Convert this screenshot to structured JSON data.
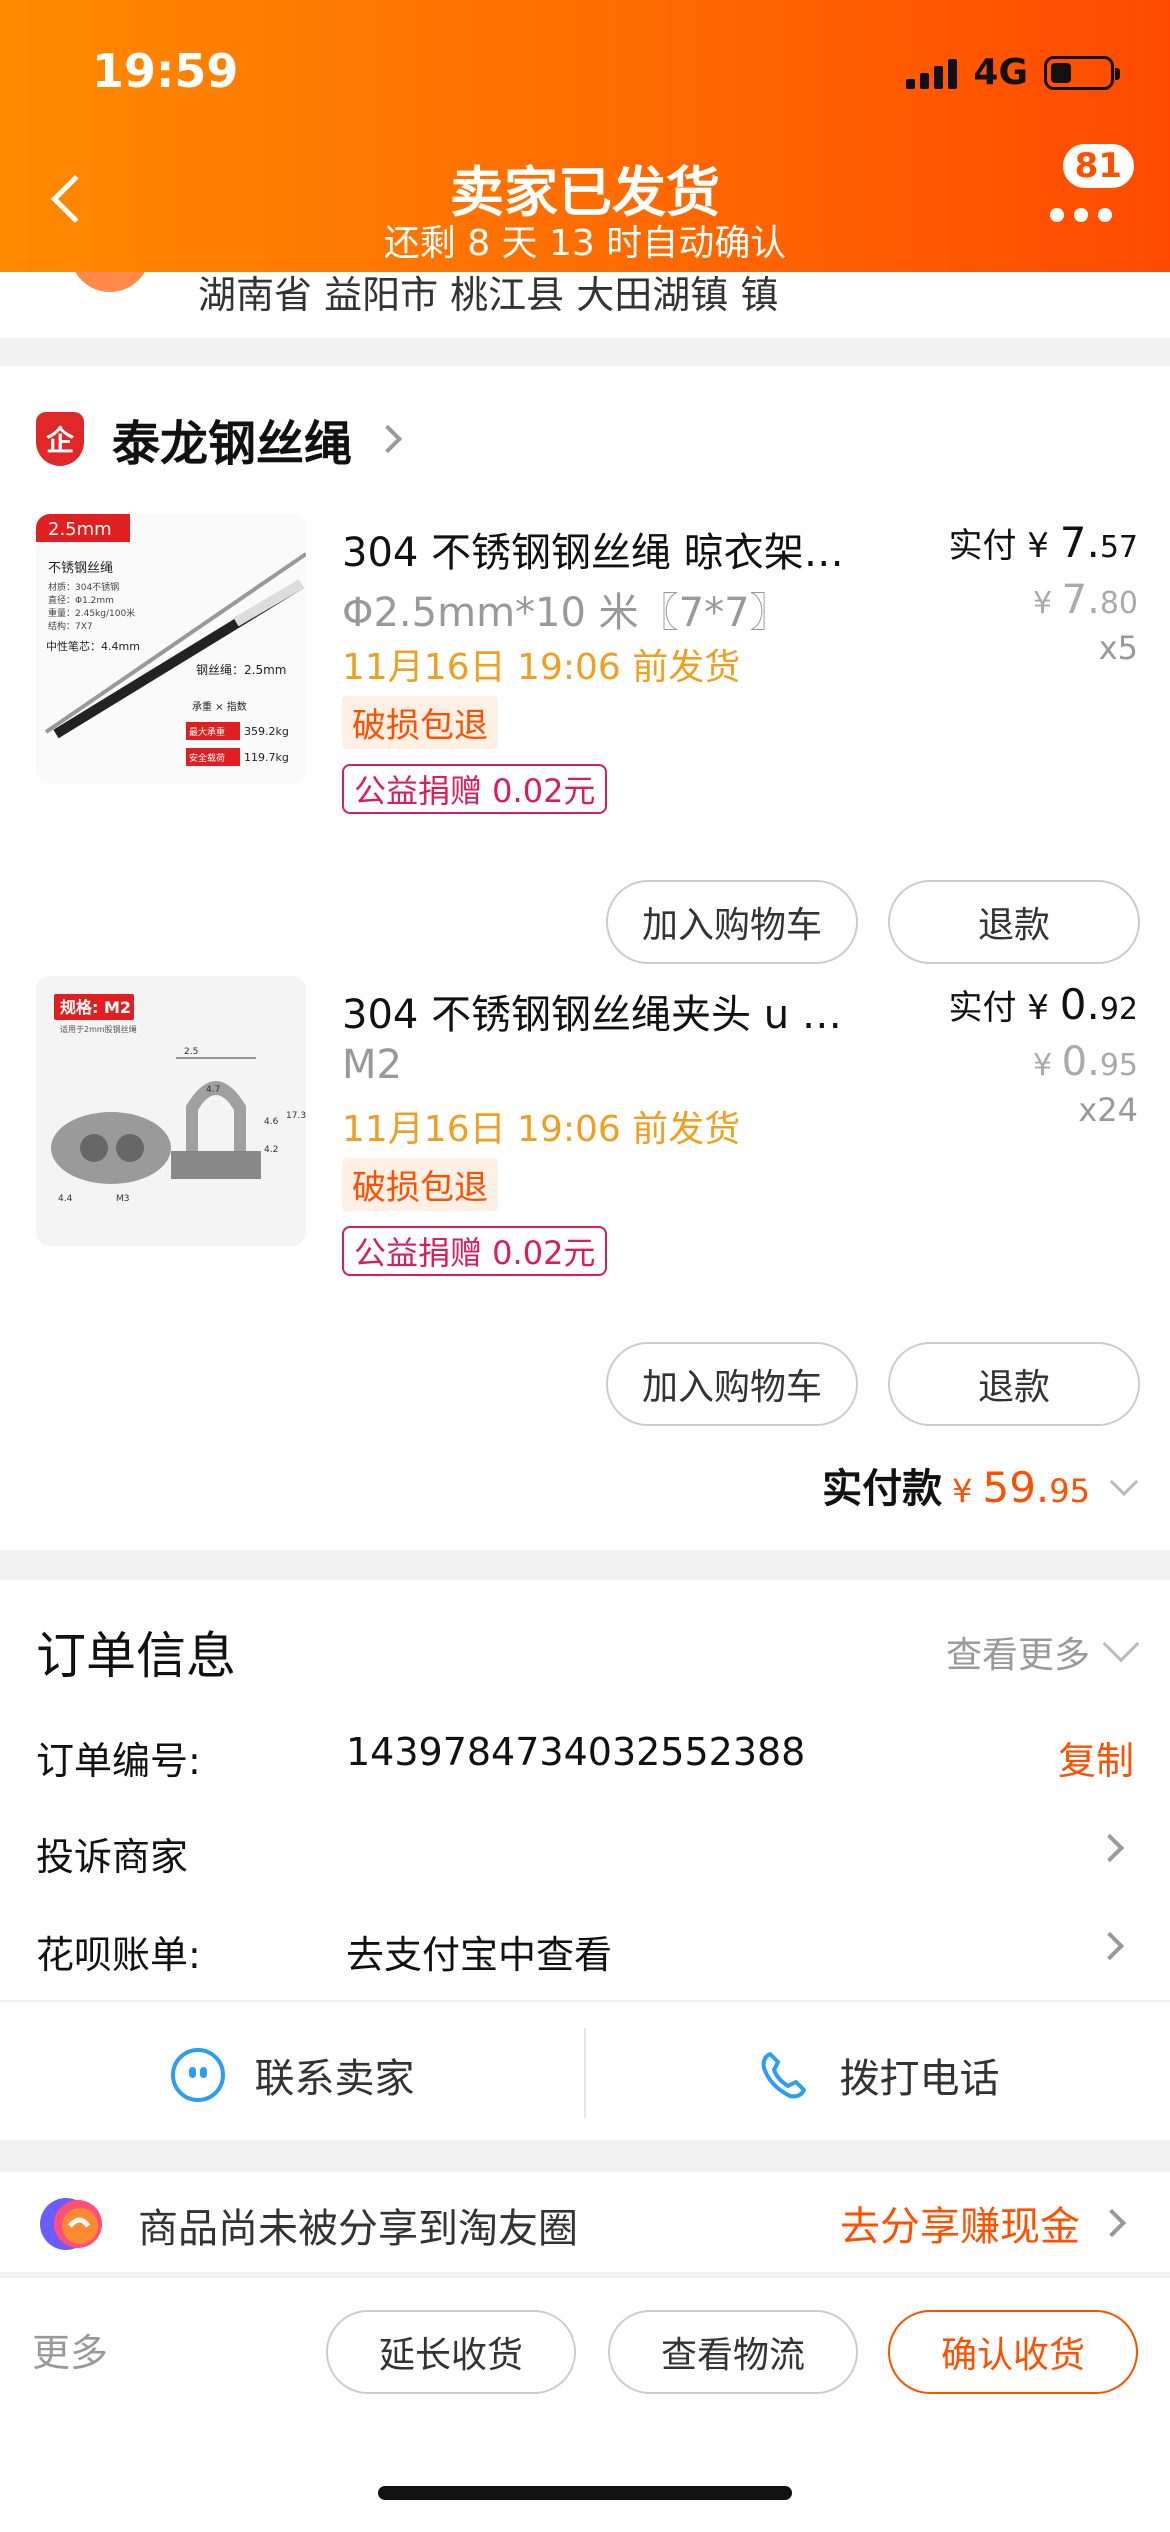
{
  "status": {
    "time": "19:59",
    "network": "4G"
  },
  "header": {
    "title": "卖家已发货",
    "subtitle": "还剩 8 天 13 时自动确认",
    "badge": "81"
  },
  "address": {
    "partial": "湖南省 益阳市 桃江县 大田湖镇 镇"
  },
  "shop": {
    "icon_text": "企",
    "name": "泰龙钢丝绳"
  },
  "items": [
    {
      "title": "304 不锈钢钢丝绳 晾衣架…",
      "spec": "Φ2.5mm*10 米〖7*7〗",
      "ship": "11月16日 19:06 前发货",
      "tag_damage": "破损包退",
      "tag_charity": "公益捐赠 0.02元",
      "paid_label": "实付 ¥",
      "paid_int": "7.",
      "paid_dec": "57",
      "orig_sym": "¥ ",
      "orig_int": "7.",
      "orig_dec": "80",
      "qty": "x5",
      "thumb": {
        "corner": "2.5mm",
        "title": "不锈钢丝绳",
        "spec1": "材质：304不锈钢",
        "spec2": "直径：Φ1.2mm",
        "spec3": "重量：2.45kg/100米",
        "spec4": "结构：7X7",
        "pen": "中性笔芯：4.4mm",
        "rope": "钢丝绳：2.5mm",
        "load_title": "承重 × 指数",
        "load1_k": "最大承重",
        "load1_v": "359.2kg",
        "load2_k": "安全载荷",
        "load2_v": "119.7kg"
      },
      "btn_cart": "加入购物车",
      "btn_refund": "退款"
    },
    {
      "title": "304 不锈钢钢丝绳夹头 u 型…",
      "spec": "M2",
      "ship": "11月16日 19:06 前发货",
      "tag_damage": "破损包退",
      "tag_charity": "公益捐赠 0.02元",
      "paid_label": "实付 ¥",
      "paid_int": "0.",
      "paid_dec": "92",
      "orig_sym": "¥ ",
      "orig_int": "0.",
      "orig_dec": "95",
      "qty": "x24",
      "thumb": {
        "corner": "规格: M2",
        "sub": "适用于2mm股钢丝绳",
        "d1": "2.5",
        "d2": "4.7",
        "d3": "4.6",
        "d4": "17.3",
        "d5": "4.2",
        "d6": "M3",
        "d7": "4.4"
      },
      "btn_cart": "加入购物车",
      "btn_refund": "退款"
    }
  ],
  "total": {
    "label": "实付款",
    "symbol": "¥",
    "int": "59.",
    "dec": "95"
  },
  "order": {
    "title": "订单信息",
    "more": "查看更多",
    "number_label": "订单编号:",
    "number_value": "1439784734032552388",
    "copy": "复制",
    "complain": "投诉商家",
    "huabei_label": "花呗账单:",
    "huabei_value": "去支付宝中查看",
    "contact_seller": "联系卖家",
    "call_phone": "拨打电话"
  },
  "share": {
    "text": "商品尚未被分享到淘友圈",
    "cta": "去分享赚现金"
  },
  "bottom": {
    "more": "更多",
    "extend": "延长收货",
    "logistics": "查看物流",
    "confirm": "确认收货"
  },
  "colors": {
    "accent": "#ff5000",
    "header_start": "#ff8a00",
    "header_end": "#ff4a00",
    "ship_orange": "#f0a020",
    "charity": "#d81e5b",
    "link_blue": "#2a9df4"
  }
}
